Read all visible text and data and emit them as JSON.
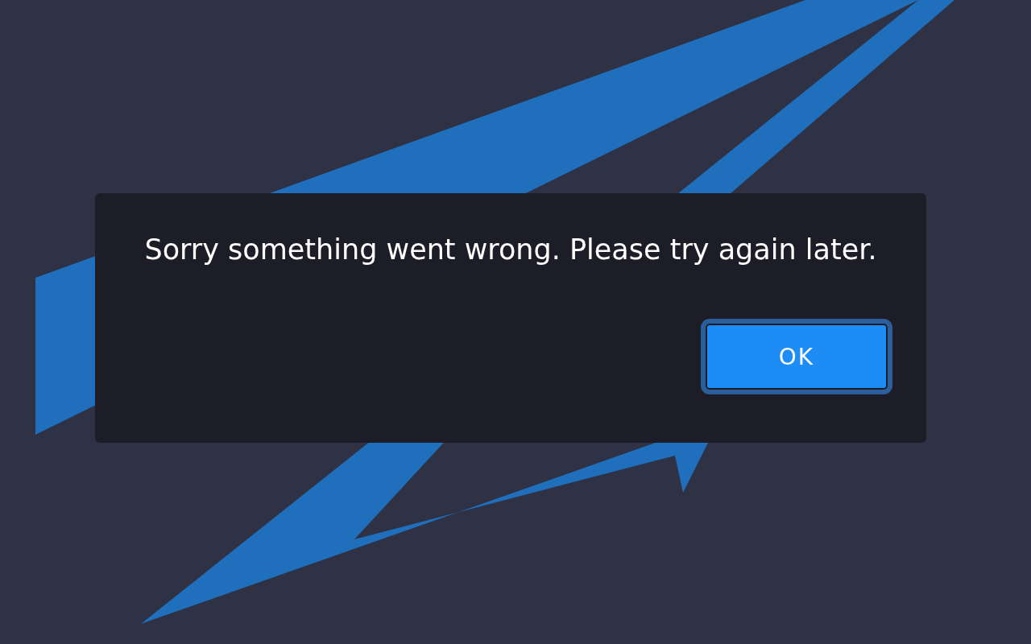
{
  "dialog": {
    "message": "Sorry something went wrong. Please try again later.",
    "buttons": [
      {
        "label": "OK",
        "focused": true
      }
    ]
  }
}
